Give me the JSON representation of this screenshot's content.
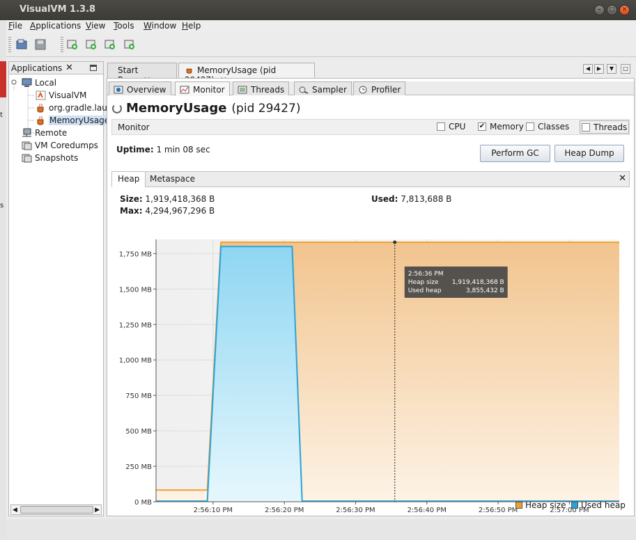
{
  "window": {
    "title": "VisualVM 1.3.8"
  },
  "menu": [
    {
      "pre": "",
      "u": "F",
      "post": "ile"
    },
    {
      "pre": "",
      "u": "A",
      "post": "pplications"
    },
    {
      "pre": "",
      "u": "V",
      "post": "iew"
    },
    {
      "pre": "",
      "u": "T",
      "post": "ools"
    },
    {
      "pre": "",
      "u": "W",
      "post": "indow"
    },
    {
      "pre": "",
      "u": "H",
      "post": "elp"
    }
  ],
  "applications_panel": {
    "tab_label": "Applications",
    "tree": {
      "local": "Local",
      "visualvm": "VisualVM",
      "gradle": "org.gradle.lau",
      "memoryusage": "MemoryUsage",
      "remote": "Remote",
      "coredumps": "VM Coredumps",
      "snapshots": "Snapshots"
    }
  },
  "doc_tabs": {
    "start_page": "Start Page",
    "memoryusage": "MemoryUsage (pid 29427)"
  },
  "sub_tabs": {
    "overview": "Overview",
    "monitor": "Monitor",
    "threads": "Threads",
    "sampler": "Sampler",
    "profiler": "Profiler"
  },
  "heading": {
    "name": "MemoryUsage",
    "pid": "(pid 29427)"
  },
  "monitor_bar": {
    "label": "Monitor",
    "cpu": "CPU",
    "cpu_checked": false,
    "memory": "Memory",
    "memory_checked": true,
    "classes": "Classes",
    "classes_checked": false,
    "threads": "Threads",
    "threads_checked": false
  },
  "uptime": {
    "label": "Uptime:",
    "value": "1 min 08 sec"
  },
  "buttons": {
    "perform_gc": "Perform GC",
    "heap_dump": "Heap Dump"
  },
  "heap_tabs": {
    "heap": "Heap",
    "metaspace": "Metaspace"
  },
  "heap_stats": {
    "size_label": "Size:",
    "size_value": "1,919,418,368 B",
    "used_label": "Used:",
    "used_value": "7,813,688 B",
    "max_label": "Max:",
    "max_value": "4,294,967,296 B"
  },
  "tooltip": {
    "time": "2:56:36 PM",
    "heap_size_label": "Heap size",
    "heap_size_value": "1,919,418,368 B",
    "used_heap_label": "Used heap",
    "used_heap_value": "3,855,432 B"
  },
  "colors": {
    "heap_size": "#f0a030",
    "used_heap": "#2aa3d6",
    "accent": "#dd4814"
  },
  "chart_data": {
    "type": "area",
    "ylim": [
      0,
      1850
    ],
    "y_ticks": [
      0,
      250,
      500,
      750,
      1000,
      1250,
      1500,
      1750
    ],
    "y_tick_labels": [
      "0 MB",
      "250 MB",
      "500 MB",
      "750 MB",
      "1,000 MB",
      "1,250 MB",
      "1,500 MB",
      "1,750 MB"
    ],
    "x_range_sec": [
      0,
      65
    ],
    "x_ticks": [
      8,
      18,
      28,
      38,
      48,
      58
    ],
    "x_tick_labels": [
      "2:56:10 PM",
      "2:56:20 PM",
      "2:56:30 PM",
      "2:56:40 PM",
      "2:56:50 PM",
      "2:57:00 PM"
    ],
    "cursor_x": 33.5,
    "series": [
      {
        "name": "Heap size",
        "x": [
          0,
          7.2,
          9.1,
          65
        ],
        "values": [
          82,
          82,
          1830,
          1830
        ]
      },
      {
        "name": "Used heap",
        "x": [
          0,
          7.2,
          9.1,
          19.1,
          20.5,
          21.3,
          45,
          65
        ],
        "values": [
          4,
          4,
          1800,
          1800,
          4,
          4,
          4,
          4
        ]
      }
    ]
  }
}
